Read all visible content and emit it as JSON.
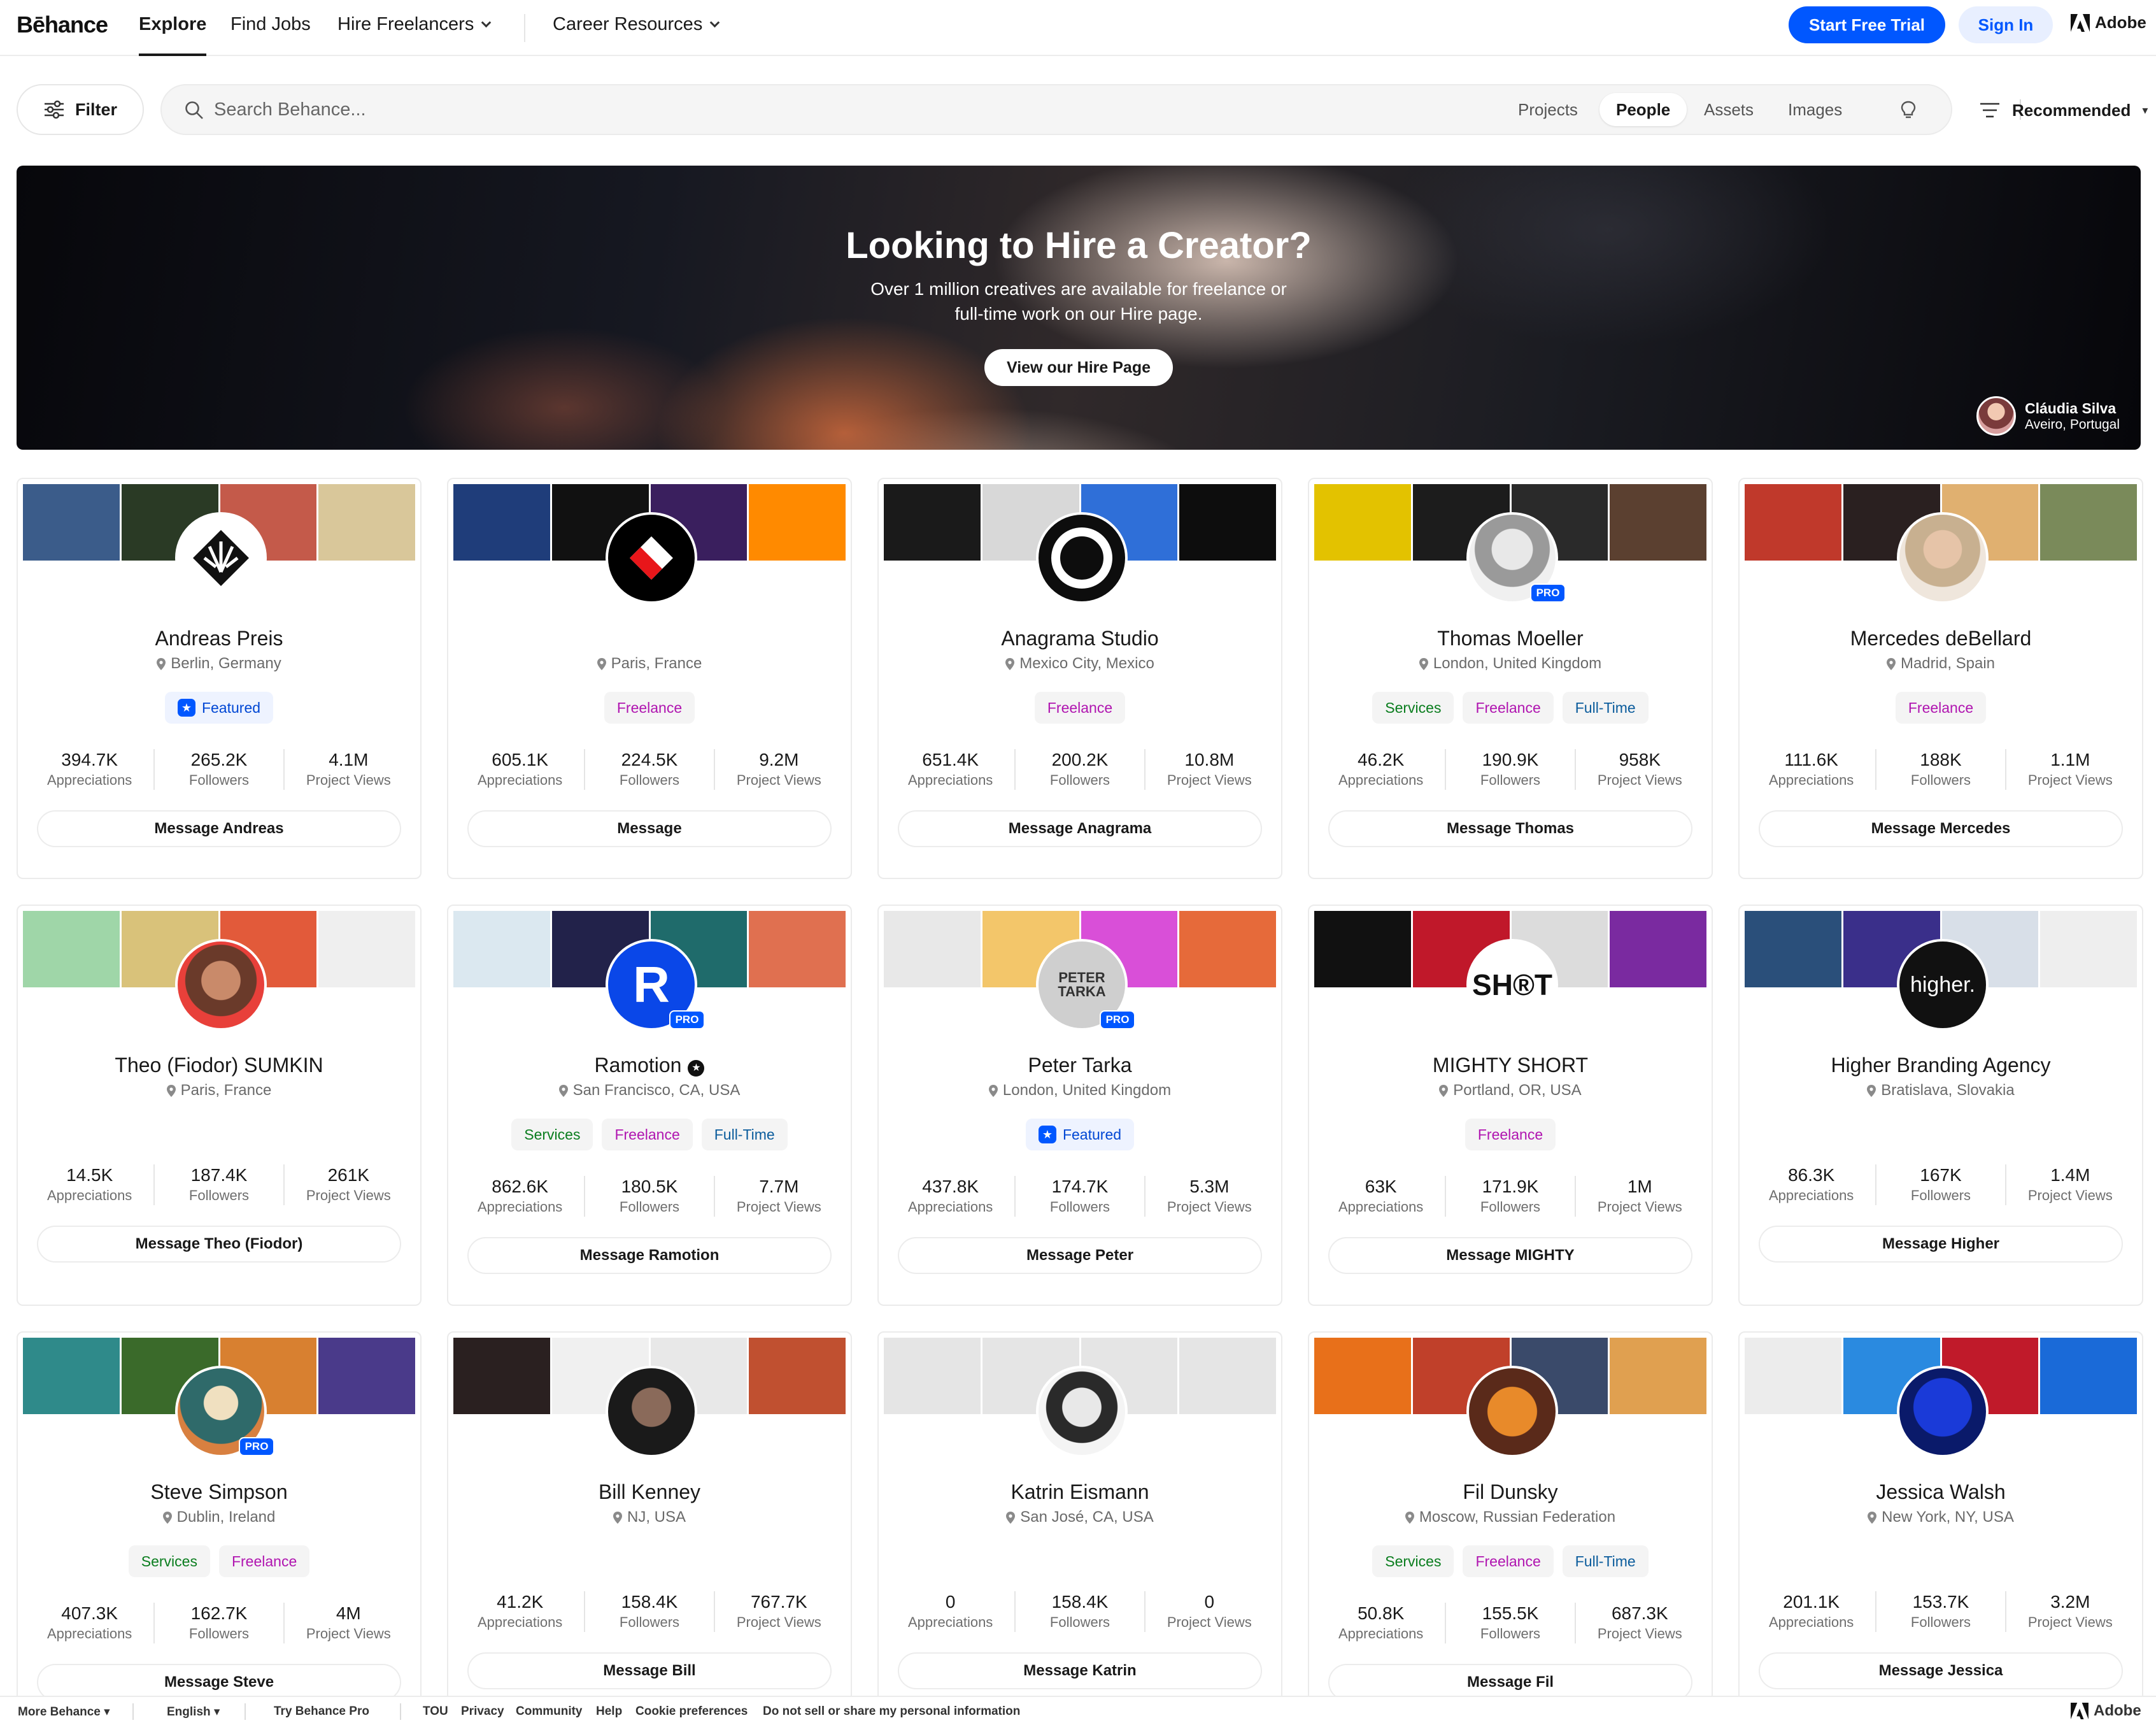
{
  "nav": {
    "logo": "Bēhance",
    "explore": "Explore",
    "find_jobs": "Find Jobs",
    "hire_freelancers": "Hire Freelancers",
    "career_resources": "Career Resources",
    "start_trial": "Start Free Trial",
    "sign_in": "Sign In",
    "adobe": "Adobe"
  },
  "search": {
    "filter_label": "Filter",
    "placeholder": "Search Behance...",
    "tabs": [
      "Projects",
      "People",
      "Assets",
      "Images"
    ],
    "active_tab": "People",
    "sort_label": "Recommended"
  },
  "hero": {
    "title": "Looking to Hire a Creator?",
    "subtitle": "Over 1 million creatives are available for freelance or full-time work on our Hire page.",
    "button": "View our Hire Page",
    "credit_name": "Cláudia Silva",
    "credit_location": "Aveiro, Portugal"
  },
  "colors": {
    "accent": "#0057ff",
    "services": "#0a7d1e",
    "freelance": "#b015b0",
    "fulltime": "#0b5c9c"
  },
  "stat_labels": [
    "Appreciations",
    "Followers",
    "Project Views"
  ],
  "creators": [
    {
      "name": "Andreas Preis",
      "location": "Berlin, Germany",
      "pro": false,
      "verified": false,
      "badges": [
        "Featured"
      ],
      "stats": [
        "394.7K",
        "265.2K",
        "4.1M"
      ],
      "message": "Message Andreas"
    },
    {
      "name": "",
      "location": "Paris, France",
      "pro": false,
      "verified": false,
      "badges": [
        "Freelance"
      ],
      "stats": [
        "605.1K",
        "224.5K",
        "9.2M"
      ],
      "message": "Message"
    },
    {
      "name": "Anagrama Studio",
      "location": "Mexico City, Mexico",
      "pro": false,
      "verified": false,
      "badges": [
        "Freelance"
      ],
      "stats": [
        "651.4K",
        "200.2K",
        "10.8M"
      ],
      "message": "Message Anagrama"
    },
    {
      "name": "Thomas Moeller",
      "location": "London, United Kingdom",
      "pro": true,
      "verified": false,
      "badges": [
        "Services",
        "Freelance",
        "Full-Time"
      ],
      "stats": [
        "46.2K",
        "190.9K",
        "958K"
      ],
      "message": "Message Thomas"
    },
    {
      "name": "Mercedes deBellard",
      "location": "Madrid, Spain",
      "pro": false,
      "verified": false,
      "badges": [
        "Freelance"
      ],
      "stats": [
        "111.6K",
        "188K",
        "1.1M"
      ],
      "message": "Message Mercedes"
    },
    {
      "name": "Theo (Fiodor) SUMKIN",
      "location": "Paris, France",
      "pro": false,
      "verified": false,
      "badges": [],
      "stats": [
        "14.5K",
        "187.4K",
        "261K"
      ],
      "message": "Message Theo (Fiodor)"
    },
    {
      "name": "Ramotion",
      "location": "San Francisco, CA, USA",
      "pro": true,
      "verified": true,
      "badges": [
        "Services",
        "Freelance",
        "Full-Time"
      ],
      "stats": [
        "862.6K",
        "180.5K",
        "7.7M"
      ],
      "message": "Message Ramotion"
    },
    {
      "name": "Peter Tarka",
      "location": "London, United Kingdom",
      "pro": true,
      "verified": false,
      "badges": [
        "Featured"
      ],
      "stats": [
        "437.8K",
        "174.7K",
        "5.3M"
      ],
      "message": "Message Peter"
    },
    {
      "name": "MIGHTY SHORT",
      "location": "Portland, OR, USA",
      "pro": false,
      "verified": false,
      "badges": [
        "Freelance"
      ],
      "stats": [
        "63K",
        "171.9K",
        "1M"
      ],
      "message": "Message MIGHTY"
    },
    {
      "name": "Higher Branding Agency",
      "location": "Bratislava, Slovakia",
      "pro": false,
      "verified": false,
      "badges": [],
      "stats": [
        "86.3K",
        "167K",
        "1.4M"
      ],
      "message": "Message Higher"
    },
    {
      "name": "Steve Simpson",
      "location": "Dublin, Ireland",
      "pro": true,
      "verified": false,
      "badges": [
        "Services",
        "Freelance"
      ],
      "stats": [
        "407.3K",
        "162.7K",
        "4M"
      ],
      "message": "Message Steve"
    },
    {
      "name": "Bill Kenney",
      "location": "NJ, USA",
      "pro": false,
      "verified": false,
      "badges": [],
      "stats": [
        "41.2K",
        "158.4K",
        "767.7K"
      ],
      "message": "Message Bill"
    },
    {
      "name": "Katrin Eismann",
      "location": "San José, CA, USA",
      "pro": false,
      "verified": false,
      "badges": [],
      "stats": [
        "0",
        "158.4K",
        "0"
      ],
      "message": "Message Katrin"
    },
    {
      "name": "Fil Dunsky",
      "location": "Moscow, Russian Federation",
      "pro": false,
      "verified": false,
      "badges": [
        "Services",
        "Freelance",
        "Full-Time"
      ],
      "stats": [
        "50.8K",
        "155.5K",
        "687.3K"
      ],
      "message": "Message Fil"
    },
    {
      "name": "Jessica Walsh",
      "location": "New York, NY, USA",
      "pro": false,
      "verified": false,
      "badges": [],
      "stats": [
        "201.1K",
        "153.7K",
        "3.2M"
      ],
      "message": "Message Jessica"
    }
  ],
  "footer": {
    "more_behance": "More Behance",
    "language": "English",
    "try_pro": "Try Behance Pro",
    "links": [
      "TOU",
      "Privacy",
      "Community",
      "Help",
      "Cookie preferences",
      "Do not sell or share my personal information"
    ],
    "adobe": "Adobe"
  }
}
